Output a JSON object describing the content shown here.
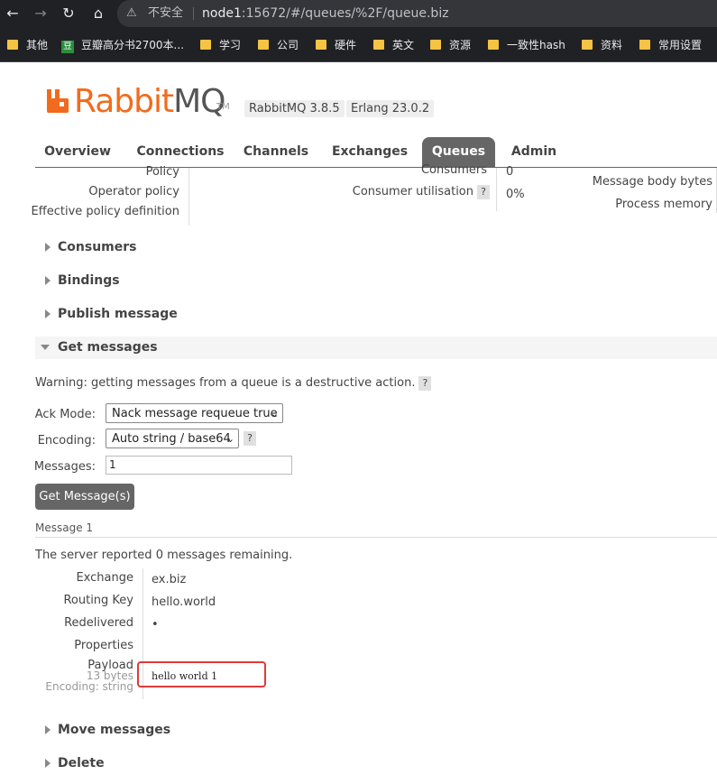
{
  "browser": {
    "back_icon": "arrow-left-icon",
    "forward_icon": "arrow-right-icon",
    "reload_icon": "reload-icon",
    "home_icon": "home-icon",
    "security_label": "不安全",
    "url_host": "node1",
    "url_rest": ":15672/#/queues/%2F/queue.biz"
  },
  "bookmarks": [
    {
      "label": "其他"
    },
    {
      "label": "豆瓣高分书2700本...",
      "icon_text": "豆"
    },
    {
      "label": "学习"
    },
    {
      "label": "公司"
    },
    {
      "label": "硬件"
    },
    {
      "label": "英文"
    },
    {
      "label": "资源"
    },
    {
      "label": "一致性hash"
    },
    {
      "label": "资料"
    },
    {
      "label": "常用设置"
    }
  ],
  "header": {
    "logo_rabbit": "Rabbit",
    "logo_mq": "MQ",
    "logo_tm": "TM",
    "version": "RabbitMQ 3.8.5",
    "erlang": "Erlang 23.0.2"
  },
  "tabs": [
    {
      "label": "Overview"
    },
    {
      "label": "Connections"
    },
    {
      "label": "Channels"
    },
    {
      "label": "Exchanges"
    },
    {
      "label": "Queues"
    },
    {
      "label": "Admin"
    }
  ],
  "details": {
    "policy_label": "Policy",
    "operator_policy_label": "Operator policy",
    "effective_policy_label": "Effective policy definition",
    "consumers_label": "Consumers",
    "consumers_value": "0",
    "consumer_util_label": "Consumer utilisation",
    "consumer_util_value": "0%",
    "message_body_bytes_label": "Message body bytes",
    "process_memory_label": "Process memory"
  },
  "sections": {
    "consumers": "Consumers",
    "bindings": "Bindings",
    "publish": "Publish message",
    "get": "Get messages",
    "move": "Move messages",
    "delete": "Delete"
  },
  "get_messages": {
    "warning": "Warning: getting messages from a queue is a destructive action.",
    "ack_mode_label": "Ack Mode:",
    "ack_mode_value": "Nack message requeue true",
    "encoding_label": "Encoding:",
    "encoding_value": "Auto string / base64",
    "messages_label": "Messages:",
    "messages_value": "1",
    "button": "Get Message(s)",
    "help": "?"
  },
  "message": {
    "heading": "Message 1",
    "remaining_prefix": "The server reported ",
    "remaining_count": "0",
    "remaining_suffix": " messages remaining.",
    "exchange_label": "Exchange",
    "exchange_value": "ex.biz",
    "routing_key_label": "Routing Key",
    "routing_key_value": "hello.world",
    "redelivered_label": "Redelivered",
    "redelivered_value": "•",
    "properties_label": "Properties",
    "payload_label": "Payload",
    "payload_size": "13 bytes",
    "payload_encoding": "Encoding: string",
    "payload_value": "hello world 1"
  }
}
